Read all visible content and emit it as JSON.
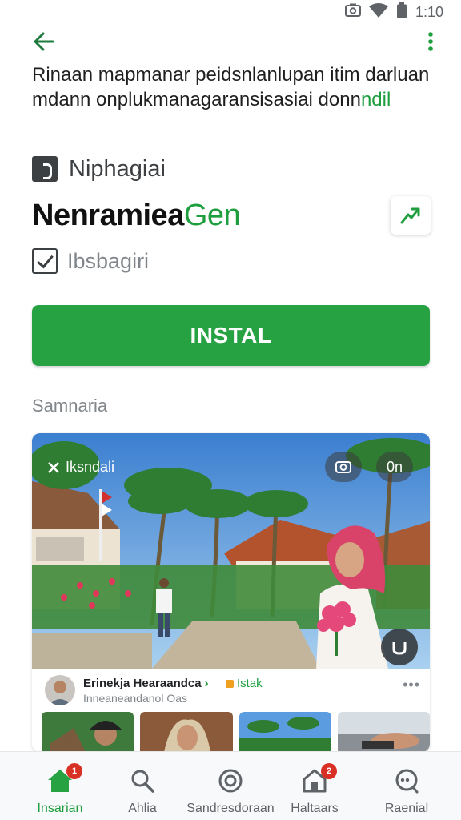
{
  "status_bar": {
    "time": "1:10",
    "icons": [
      "camera-icon",
      "wifi-icon",
      "battery-icon"
    ]
  },
  "top_bar": {
    "back_icon": "arrow-back-icon",
    "more_icon": "more-vert-icon"
  },
  "description": {
    "text": "Rinaan mapmanar peidsnlanlupan itim darluan mdann onplukmanagaransisasiai donn",
    "accent": "ndil"
  },
  "developer": {
    "name": "Niphagiai",
    "icon": "developer-icon"
  },
  "app": {
    "title": "Nenramiea",
    "title_accent": "Gen",
    "share_icon": "share-icon"
  },
  "checkbox": {
    "label": "Ibsbagiri",
    "checked": true
  },
  "install": {
    "label": "INSTAL"
  },
  "section": {
    "label": "Samnaria"
  },
  "media": {
    "overlay_label": "Iksndali",
    "camera_btn_icon": "camera-icon",
    "toggle_label": "0n",
    "video_icon": "video-icon"
  },
  "post": {
    "name": "Erinekja Hearaandca",
    "tag": "Istak",
    "subtitle": "Inneaneandanol Oas",
    "more": "•••"
  },
  "nav": {
    "items": [
      {
        "label": "Insarian",
        "icon": "home-icon",
        "badge": "1"
      },
      {
        "label": "Ahlia",
        "icon": "search-icon"
      },
      {
        "label": "Sandresdoraan",
        "icon": "discover-icon"
      },
      {
        "label": "Haltaars",
        "icon": "store-icon",
        "badge": "2"
      },
      {
        "label": "Raenial",
        "icon": "chat-icon"
      }
    ]
  },
  "colors": {
    "accent": "#27a243",
    "text": "#202124",
    "muted": "#80868b"
  }
}
